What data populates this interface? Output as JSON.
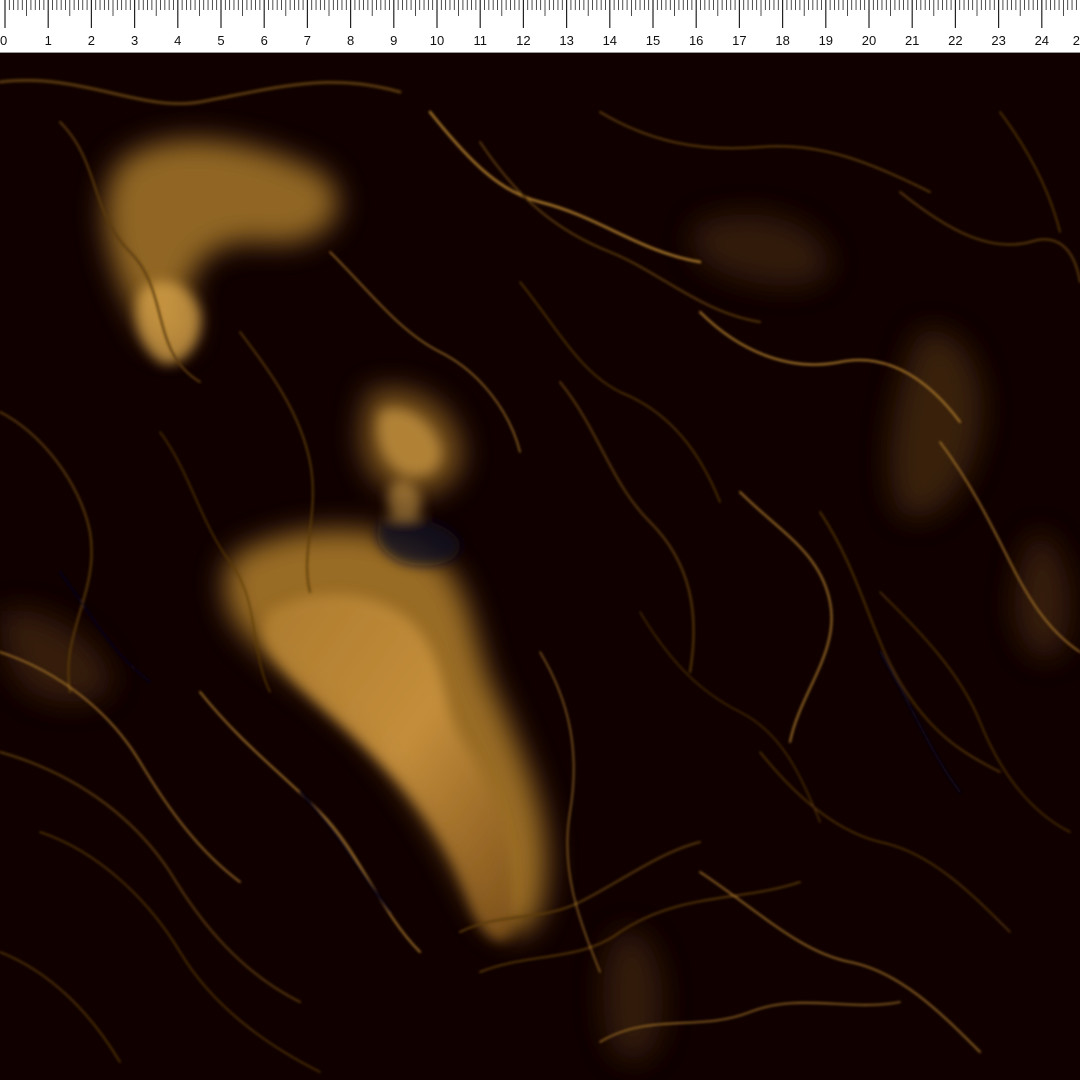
{
  "ruler": {
    "labels": [
      "0",
      "1",
      "2",
      "3",
      "4",
      "5",
      "6",
      "7",
      "8",
      "9",
      "10",
      "11",
      "12",
      "13",
      "14",
      "15",
      "16",
      "17",
      "18",
      "19",
      "20",
      "21",
      "22",
      "23",
      "24",
      "2"
    ],
    "minor_divisions": 10
  },
  "fabric": {
    "pattern": "marble-swirl",
    "colors": {
      "base": "#100000",
      "deep": "#050000",
      "bronze": "#5a3a10",
      "gold": "#a8782a",
      "highlight": "#d6a24a",
      "navy": "#0c0a22"
    }
  }
}
